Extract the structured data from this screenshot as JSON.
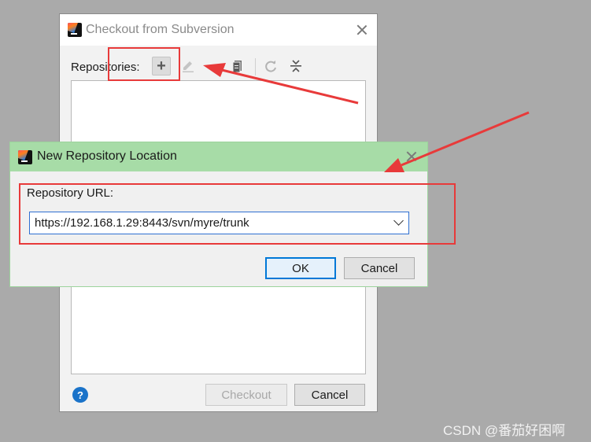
{
  "checkout_dialog": {
    "title": "Checkout from Subversion",
    "repositories_label": "Repositories:",
    "toolbar": {
      "add_icon": "plus-icon",
      "edit_icon": "pencil-icon",
      "browse_icon": "document-icon",
      "refresh_icon": "refresh-icon",
      "collapse_icon": "collapse-icon",
      "add_glyph": "+"
    },
    "checkout_label": "Checkout",
    "cancel_label": "Cancel",
    "help_glyph": "?"
  },
  "location_dialog": {
    "title": "New Repository Location",
    "url_label": "Repository URL:",
    "url_value": "https://192.168.1.29:8443/svn/myre/trunk",
    "ok_label": "OK",
    "cancel_label": "Cancel"
  },
  "watermark": "CSDN @番茄好困啊",
  "colors": {
    "annotation_red": "#e83a3a",
    "inner_titlebar": "#a7dca7",
    "focus_blue": "#0078d7"
  }
}
